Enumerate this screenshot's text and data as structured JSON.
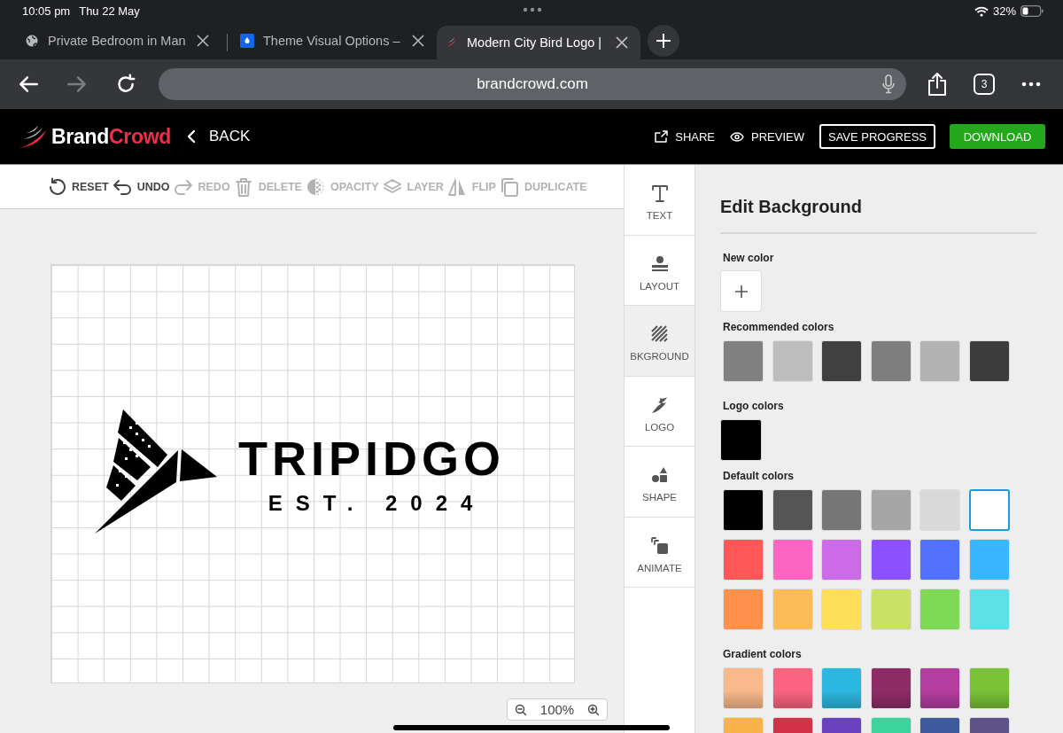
{
  "status_bar": {
    "time": "10:05 pm",
    "date": "Thu 22 May",
    "battery": "32%"
  },
  "browser_tabs": [
    {
      "kind": "globe",
      "title": "Private Bedroom in Man",
      "selected": false
    },
    {
      "kind": "droplet",
      "title": "Theme Visual Options –",
      "selected": false
    },
    {
      "kind": "bird",
      "title": "Modern City Bird Logo |",
      "selected": true
    }
  ],
  "nav_buttons": [
    {
      "kind": "back",
      "disabled": false
    },
    {
      "kind": "forward",
      "disabled": true
    },
    {
      "kind": "reload",
      "disabled": false
    }
  ],
  "address_bar": {
    "value": "brandcrowd.com"
  },
  "tab_count": "3",
  "app_header": {
    "logo": {
      "first": "Brand",
      "second": "Crowd"
    },
    "back": "BACK",
    "actions": [
      {
        "kind": "share",
        "label": "SHARE"
      },
      {
        "kind": "preview",
        "label": "PREVIEW"
      },
      {
        "kind": "outline",
        "label": "SAVE PROGRESS"
      },
      {
        "kind": "primary",
        "label": "DOWNLOAD"
      }
    ]
  },
  "edit_tools": [
    {
      "kind": "reset",
      "label": "RESET",
      "disabled": false
    },
    {
      "kind": "undo",
      "label": "UNDO",
      "disabled": false
    },
    {
      "kind": "redo",
      "label": "REDO",
      "disabled": true
    },
    {
      "kind": "delete",
      "label": "DELETE",
      "disabled": true
    },
    {
      "kind": "opacity",
      "label": "OPACITY",
      "disabled": true
    },
    {
      "kind": "layer",
      "label": "LAYER",
      "disabled": true
    },
    {
      "kind": "flip",
      "label": "FLIP",
      "disabled": true
    },
    {
      "kind": "duplicate",
      "label": "DUPLICATE",
      "disabled": true
    }
  ],
  "artboard": {
    "title": "TRIPIDGO",
    "subtitle": "EST. 2024"
  },
  "zoom": {
    "value": "100%"
  },
  "side_tabs": [
    {
      "kind": "text",
      "label": "TEXT",
      "selected": false
    },
    {
      "kind": "layout",
      "label": "LAYOUT",
      "selected": false
    },
    {
      "kind": "background",
      "label": "BKGROUND",
      "selected": true
    },
    {
      "kind": "logo",
      "label": "LOGO",
      "selected": false
    },
    {
      "kind": "shape",
      "label": "SHAPE",
      "selected": false
    },
    {
      "kind": "animate",
      "label": "ANIMATE",
      "selected": false
    }
  ],
  "panel": {
    "title": "Edit Background",
    "new_color_label": "New color",
    "recommended_label": "Recommended colors",
    "recommended_colors": [
      {
        "color": "#808080",
        "selected": false
      },
      {
        "color": "#bdbdbd",
        "selected": false
      },
      {
        "color": "#404040",
        "selected": false
      },
      {
        "color": "#7e7e7e",
        "selected": false
      },
      {
        "color": "#b3b3b3",
        "selected": false
      },
      {
        "color": "#3c3c3c",
        "selected": false
      }
    ],
    "logo_label": "Logo colors",
    "logo_colors": [
      {
        "color": "#000000",
        "selected": false
      }
    ],
    "default_label": "Default colors",
    "default_colors": [
      {
        "color": "#000000",
        "selected": false
      },
      {
        "color": "#555555",
        "selected": false
      },
      {
        "color": "#777777",
        "selected": false
      },
      {
        "color": "#a6a6a6",
        "selected": false
      },
      {
        "color": "#d9d9d9",
        "selected": false
      },
      {
        "color": "#ffffff",
        "selected": true
      },
      {
        "color": "#ff5757",
        "selected": false
      },
      {
        "color": "#ff66c4",
        "selected": false
      },
      {
        "color": "#cb6ce6",
        "selected": false
      },
      {
        "color": "#8c52ff",
        "selected": false
      },
      {
        "color": "#5271ff",
        "selected": false
      },
      {
        "color": "#38b6ff",
        "selected": false
      },
      {
        "color": "#ff914d",
        "selected": false
      },
      {
        "color": "#ffbd59",
        "selected": false
      },
      {
        "color": "#ffde59",
        "selected": false
      },
      {
        "color": "#c9e265",
        "selected": false
      },
      {
        "color": "#7ed957",
        "selected": false
      },
      {
        "color": "#5ce1e6",
        "selected": false
      }
    ],
    "gradient_label": "Gradient colors",
    "gradient_colors": [
      {
        "kind": "gradient",
        "color": "#f9b98b",
        "selected": false
      },
      {
        "kind": "gradient",
        "color": "#fb6480",
        "selected": false
      },
      {
        "kind": "gradient",
        "color": "#2bb8e0",
        "selected": false
      },
      {
        "kind": "gradient",
        "color": "#8e2c68",
        "selected": false
      },
      {
        "kind": "gradient",
        "color": "#b43ea0",
        "selected": false
      },
      {
        "kind": "gradient",
        "color": "#7ac236",
        "selected": false
      },
      {
        "kind": "gradient",
        "color": "#f9b24a",
        "selected": false
      },
      {
        "kind": "gradient",
        "color": "#d23248",
        "selected": false
      },
      {
        "kind": "gradient",
        "color": "#6a42c0",
        "selected": false
      },
      {
        "kind": "gradient",
        "color": "#3cd49c",
        "selected": false
      },
      {
        "kind": "gradient",
        "color": "#3c5a9c",
        "selected": false
      },
      {
        "kind": "gradient",
        "color": "#5e5288",
        "selected": false
      }
    ]
  }
}
